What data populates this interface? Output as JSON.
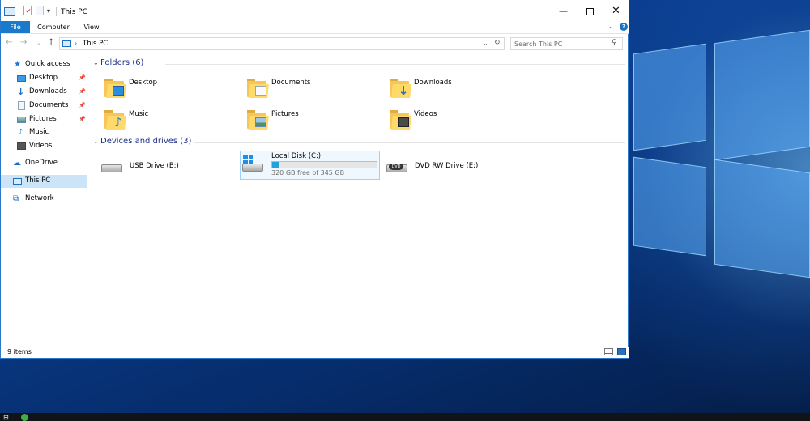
{
  "window": {
    "title": "This PC",
    "controls": {
      "minimize": "—",
      "maximize": "",
      "close": "✕"
    }
  },
  "ribbon": {
    "tabs": [
      "File",
      "Computer",
      "View"
    ]
  },
  "address": {
    "path": "This PC",
    "search_placeholder": "Search This PC"
  },
  "nav_pane": {
    "items": [
      {
        "label": "Quick access",
        "icon": "star-icon"
      },
      {
        "label": "Desktop",
        "icon": "desktop-icon",
        "pinned": true
      },
      {
        "label": "Downloads",
        "icon": "download-icon",
        "pinned": true
      },
      {
        "label": "Documents",
        "icon": "document-icon",
        "pinned": true
      },
      {
        "label": "Pictures",
        "icon": "pictures-icon",
        "pinned": true
      },
      {
        "label": "Music",
        "icon": "music-icon"
      },
      {
        "label": "Videos",
        "icon": "videos-icon"
      },
      {
        "label": "OneDrive",
        "icon": "cloud-icon"
      },
      {
        "label": "This PC",
        "icon": "computer-icon",
        "selected": true
      },
      {
        "label": "Network",
        "icon": "network-icon"
      }
    ]
  },
  "folders": {
    "heading": "Folders (6)",
    "items": [
      {
        "label": "Desktop",
        "icon": "desktop-folder-icon"
      },
      {
        "label": "Documents",
        "icon": "documents-folder-icon"
      },
      {
        "label": "Downloads",
        "icon": "downloads-folder-icon"
      },
      {
        "label": "Music",
        "icon": "music-folder-icon"
      },
      {
        "label": "Pictures",
        "icon": "pictures-folder-icon"
      },
      {
        "label": "Videos",
        "icon": "videos-folder-icon"
      }
    ]
  },
  "drives": {
    "heading": "Devices and drives (3)",
    "items": [
      {
        "label": "USB Drive (B:)",
        "icon": "usb-drive-icon"
      },
      {
        "label": "Local Disk (C:)",
        "icon": "hard-drive-icon",
        "free_text": "320 GB free of 345 GB",
        "used_fraction": 0.07,
        "selected": true
      },
      {
        "label": "DVD RW Drive (E:)",
        "icon": "dvd-drive-icon",
        "badge": "DVD"
      }
    ]
  },
  "status": {
    "item_count": "9 items"
  },
  "colors": {
    "accent": "#1979ca",
    "capacity_bar": "#26a0da",
    "group_heading": "#1e3287"
  }
}
